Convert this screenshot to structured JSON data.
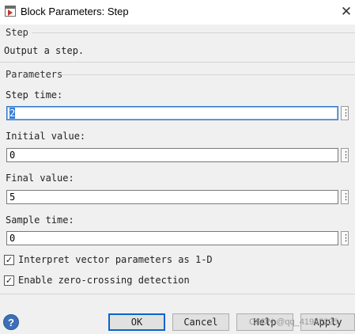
{
  "window": {
    "title": "Block Parameters: Step",
    "close_glyph": "✕"
  },
  "block_group": {
    "legend": "Step",
    "description": "Output a step."
  },
  "parameters": {
    "legend": "Parameters",
    "fields": [
      {
        "label": "Step time:",
        "value": "2",
        "focused": true
      },
      {
        "label": "Initial value:",
        "value": "0"
      },
      {
        "label": "Final value:",
        "value": "5"
      },
      {
        "label": "Sample time:",
        "value": "0"
      }
    ],
    "more_glyph": "⋮"
  },
  "checkboxes": [
    {
      "label": "Interpret vector parameters as 1-D",
      "checked": true
    },
    {
      "label": "Enable zero-crossing detection",
      "checked": true
    }
  ],
  "buttons": {
    "help_glyph": "?",
    "ok": "OK",
    "cancel": "Cancel",
    "help": "Help",
    "apply": "Apply"
  },
  "watermark": "CSDN @qq_41955225",
  "colors": {
    "background": "#f0f0f0",
    "focus_border": "#2b76c6",
    "selection": "#3b7dd8",
    "default_button_border": "#0a64c8",
    "help_icon": "#3d6eb7"
  }
}
